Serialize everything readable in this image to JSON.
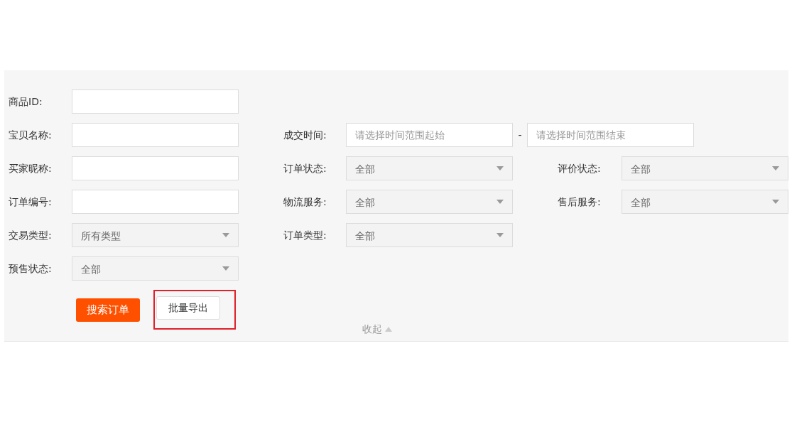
{
  "rows": [
    {
      "left": {
        "kind": "text",
        "label": "商品ID:"
      }
    },
    {
      "left": {
        "kind": "text",
        "label": "宝贝名称:"
      },
      "middle": {
        "kind": "date_range",
        "label": "成交时间:",
        "placeholder": "请选择时间范围起始",
        "separator": "-",
        "placeholder_end": "请选择时间范围结束"
      }
    },
    {
      "left": {
        "kind": "text",
        "label": "买家昵称:"
      },
      "middle": {
        "kind": "select",
        "label": "订单状态:",
        "value": "全部"
      },
      "right": {
        "kind": "select",
        "label": "评价状态:",
        "value": "全部"
      }
    },
    {
      "left": {
        "kind": "text",
        "label": "订单编号:"
      },
      "middle": {
        "kind": "select",
        "label": "物流服务:",
        "value": "全部"
      },
      "right": {
        "kind": "select",
        "label": "售后服务:",
        "value": "全部"
      }
    },
    {
      "left": {
        "kind": "select",
        "label": "交易类型:",
        "value": "所有类型"
      },
      "middle": {
        "kind": "select",
        "label": "订单类型:",
        "value": "全部"
      }
    },
    {
      "left": {
        "kind": "select",
        "label": "预售状态:",
        "value": "全部"
      }
    }
  ],
  "buttons": [
    {
      "label": "搜索订单",
      "kind": "primary",
      "highlighted": false
    },
    {
      "label": "批量导出",
      "kind": "default",
      "highlighted": true
    }
  ],
  "collapse": {
    "label": "收起"
  }
}
